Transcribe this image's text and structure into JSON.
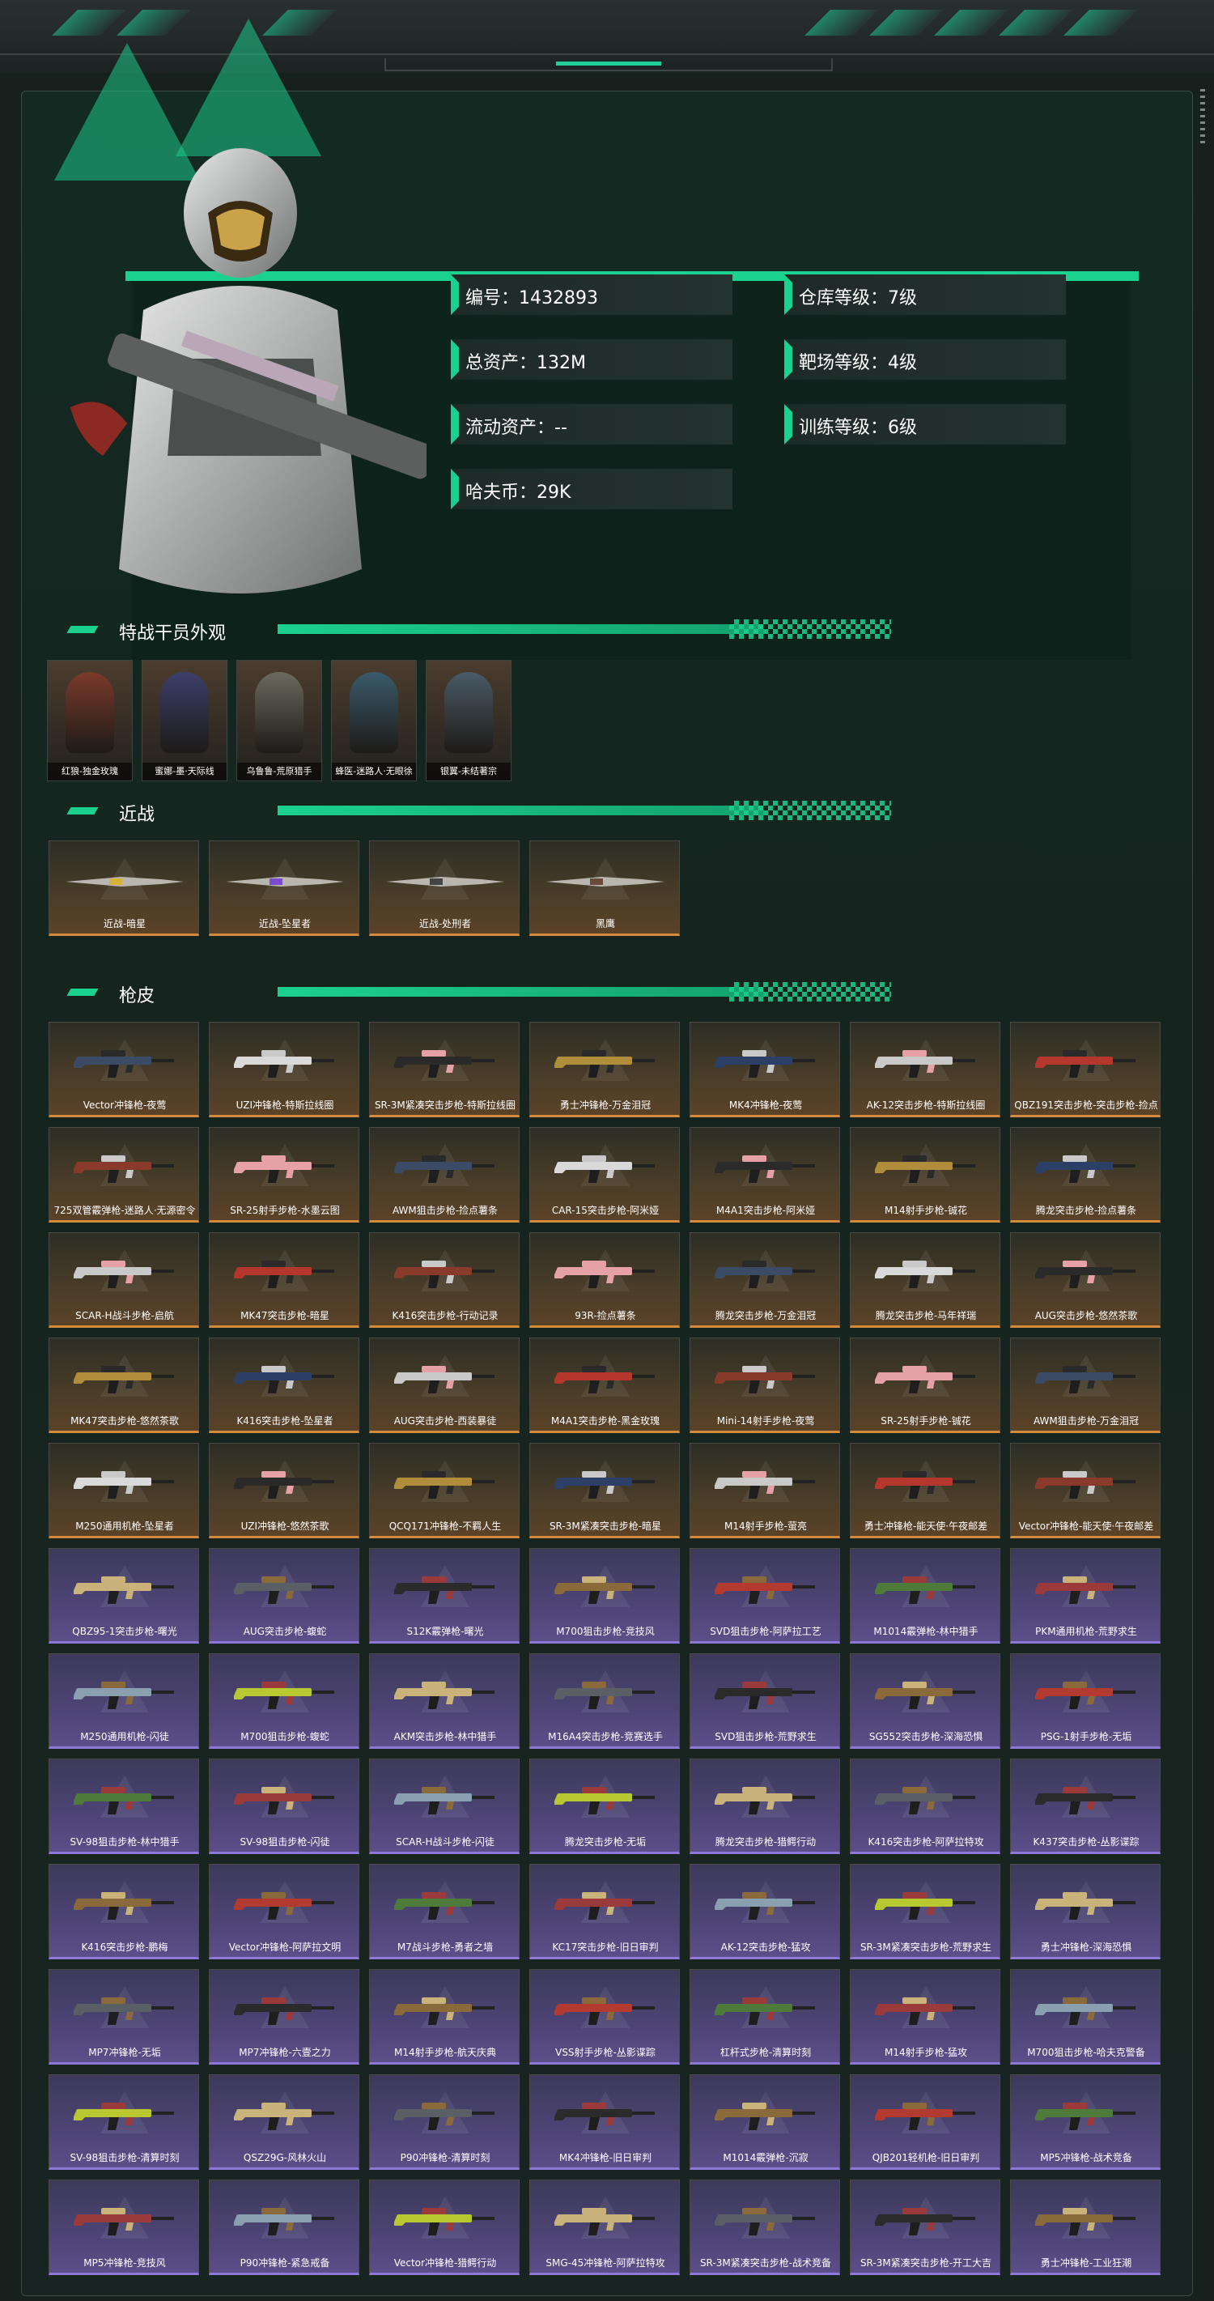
{
  "colors": {
    "accent": "#1bd18e",
    "gold_rarity": "#d38a3a",
    "purple_rarity": "#8e78d8"
  },
  "profile": {
    "id": "编号：1432893",
    "total_assets": "总资产：132M",
    "liquid_assets": "流动资产：--",
    "hafu_coin": "哈夫币：29K",
    "warehouse_level": "仓库等级：7级",
    "range_level": "靶场等级：4级",
    "training_level": "训练等级：6级"
  },
  "sections": {
    "operators": "特战干员外观",
    "melee": "近战",
    "gun_skins": "枪皮"
  },
  "operators": [
    {
      "label": "红狼-独金玫瑰",
      "icon": "operator-portrait-icon"
    },
    {
      "label": "蜜娜-墨·天际线",
      "icon": "operator-portrait-icon"
    },
    {
      "label": "乌鲁鲁-荒原猎手",
      "icon": "operator-portrait-icon"
    },
    {
      "label": "蜂医-迷路人·无眼徐",
      "icon": "operator-portrait-icon"
    },
    {
      "label": "银翼-未结著宗",
      "icon": "operator-portrait-icon"
    }
  ],
  "melee": [
    {
      "label": "近战-暗星",
      "icon": "knife-icon"
    },
    {
      "label": "近战-坠星者",
      "icon": "knife-icon"
    },
    {
      "label": "近战-处刑者",
      "icon": "knife-icon"
    },
    {
      "label": "黑鹰",
      "icon": "knife-icon"
    }
  ],
  "gun_skins": [
    {
      "label": "Vector冲锋枪-夜莺",
      "rarity": "gold"
    },
    {
      "label": "UZI冲锋枪-特斯拉线圈",
      "rarity": "gold"
    },
    {
      "label": "SR-3M紧凑突击步枪-特斯拉线圈",
      "rarity": "gold"
    },
    {
      "label": "勇士冲锋枪-万金泪冠",
      "rarity": "gold"
    },
    {
      "label": "MK4冲锋枪-夜莺",
      "rarity": "gold"
    },
    {
      "label": "AK-12突击步枪-特斯拉线圈",
      "rarity": "gold"
    },
    {
      "label": "QBZ191突击步枪-突击步枪-捡点",
      "rarity": "gold"
    },
    {
      "label": "725双管霰弹枪-迷路人·无源密令",
      "rarity": "gold"
    },
    {
      "label": "SR-25射手步枪-水墨云图",
      "rarity": "gold"
    },
    {
      "label": "AWM狙击步枪-捡点薯条",
      "rarity": "gold"
    },
    {
      "label": "CAR-15突击步枪-阿米娅",
      "rarity": "gold"
    },
    {
      "label": "M4A1突击步枪-阿米娅",
      "rarity": "gold"
    },
    {
      "label": "M14射手步枪-铖花",
      "rarity": "gold"
    },
    {
      "label": "腾龙突击步枪-捡点薯条",
      "rarity": "gold"
    },
    {
      "label": "SCAR-H战斗步枪-启航",
      "rarity": "gold"
    },
    {
      "label": "MK47突击步枪-暗星",
      "rarity": "gold"
    },
    {
      "label": "K416突击步枪-行动记录",
      "rarity": "gold"
    },
    {
      "label": "93R-捡点薯条",
      "rarity": "gold"
    },
    {
      "label": "腾龙突击步枪-万金泪冠",
      "rarity": "gold"
    },
    {
      "label": "腾龙突击步枪-马年祥瑞",
      "rarity": "gold"
    },
    {
      "label": "AUG突击步枪-悠然茶歌",
      "rarity": "gold"
    },
    {
      "label": "MK47突击步枪-悠然茶歌",
      "rarity": "gold"
    },
    {
      "label": "K416突击步枪-坠星者",
      "rarity": "gold"
    },
    {
      "label": "AUG突击步枪-西装暴徒",
      "rarity": "gold"
    },
    {
      "label": "M4A1突击步枪-黑金玫瑰",
      "rarity": "gold"
    },
    {
      "label": "Mini-14射手步枪-夜莺",
      "rarity": "gold"
    },
    {
      "label": "SR-25射手步枪-铖花",
      "rarity": "gold"
    },
    {
      "label": "AWM狙击步枪-万金泪冠",
      "rarity": "gold"
    },
    {
      "label": "M250通用机枪-坠星者",
      "rarity": "gold"
    },
    {
      "label": "UZI冲锋枪-悠然茶歌",
      "rarity": "gold"
    },
    {
      "label": "QCQ171冲锋枪-不羁人生",
      "rarity": "gold"
    },
    {
      "label": "SR-3M紧凑突击步枪-暗星",
      "rarity": "gold"
    },
    {
      "label": "M14射手步枪-萤亮",
      "rarity": "gold"
    },
    {
      "label": "勇士冲锋枪-能天使·午夜邮差",
      "rarity": "gold"
    },
    {
      "label": "Vector冲锋枪-能天使·午夜邮差",
      "rarity": "gold"
    },
    {
      "label": "QBZ95-1突击步枪-曙光",
      "rarity": "purple"
    },
    {
      "label": "AUG突击步枪-蝮蛇",
      "rarity": "purple"
    },
    {
      "label": "S12K霰弹枪-曙光",
      "rarity": "purple"
    },
    {
      "label": "M700狙击步枪-竞技风",
      "rarity": "purple"
    },
    {
      "label": "SVD狙击步枪-阿萨拉工艺",
      "rarity": "purple"
    },
    {
      "label": "M1014霰弹枪-林中猎手",
      "rarity": "purple"
    },
    {
      "label": "PKM通用机枪-荒野求生",
      "rarity": "purple"
    },
    {
      "label": "M250通用机枪-闪徒",
      "rarity": "purple"
    },
    {
      "label": "M700狙击步枪-蝮蛇",
      "rarity": "purple"
    },
    {
      "label": "AKM突击步枪-林中猎手",
      "rarity": "purple"
    },
    {
      "label": "M16A4突击步枪-竞赛选手",
      "rarity": "purple"
    },
    {
      "label": "SVD狙击步枪-荒野求生",
      "rarity": "purple"
    },
    {
      "label": "SG552突击步枪-深海恐惧",
      "rarity": "purple"
    },
    {
      "label": "PSG-1射手步枪-无垢",
      "rarity": "purple"
    },
    {
      "label": "SV-98狙击步枪-林中猎手",
      "rarity": "purple"
    },
    {
      "label": "SV-98狙击步枪-闪徒",
      "rarity": "purple"
    },
    {
      "label": "SCAR-H战斗步枪-闪徒",
      "rarity": "purple"
    },
    {
      "label": "腾龙突击步枪-无垢",
      "rarity": "purple"
    },
    {
      "label": "腾龙突击步枪-猎鳄行动",
      "rarity": "purple"
    },
    {
      "label": "K416突击步枪-阿萨拉特攻",
      "rarity": "purple"
    },
    {
      "label": "K437突击步枪-丛影谍踪",
      "rarity": "purple"
    },
    {
      "label": "K416突击步枪-鹏梅",
      "rarity": "purple"
    },
    {
      "label": "Vector冲锋枪-阿萨拉文明",
      "rarity": "purple"
    },
    {
      "label": "M7战斗步枪-勇者之墙",
      "rarity": "purple"
    },
    {
      "label": "KC17突击步枪-旧日审判",
      "rarity": "purple"
    },
    {
      "label": "AK-12突击步枪-猛攻",
      "rarity": "purple"
    },
    {
      "label": "SR-3M紧凑突击步枪-荒野求生",
      "rarity": "purple"
    },
    {
      "label": "勇士冲锋枪-深海恐惧",
      "rarity": "purple"
    },
    {
      "label": "MP7冲锋枪-无垢",
      "rarity": "purple"
    },
    {
      "label": "MP7冲锋枪-六壹之力",
      "rarity": "purple"
    },
    {
      "label": "M14射手步枪-航天庆典",
      "rarity": "purple"
    },
    {
      "label": "VSS射手步枪-丛影谍踪",
      "rarity": "purple"
    },
    {
      "label": "杠杆式步枪-清算时刻",
      "rarity": "purple"
    },
    {
      "label": "M14射手步枪-猛攻",
      "rarity": "purple"
    },
    {
      "label": "M700狙击步枪-哈夫克警备",
      "rarity": "purple"
    },
    {
      "label": "SV-98狙击步枪-清算时刻",
      "rarity": "purple"
    },
    {
      "label": "QSZ29G-风林火山",
      "rarity": "purple"
    },
    {
      "label": "P90冲锋枪-清算时刻",
      "rarity": "purple"
    },
    {
      "label": "MK4冲锋枪-旧日审判",
      "rarity": "purple"
    },
    {
      "label": "M1014霰弹枪-沉寂",
      "rarity": "purple"
    },
    {
      "label": "QJB201轻机枪-旧日审判",
      "rarity": "purple"
    },
    {
      "label": "MP5冲锋枪-战术竞备",
      "rarity": "purple"
    },
    {
      "label": "MP5冲锋枪-竞技风",
      "rarity": "purple"
    },
    {
      "label": "P90冲锋枪-紧急戒备",
      "rarity": "purple"
    },
    {
      "label": "Vector冲锋枪-猎鳄行动",
      "rarity": "purple"
    },
    {
      "label": "SMG-45冲锋枪-阿萨拉特攻",
      "rarity": "purple"
    },
    {
      "label": "SR-3M紧凑突击步枪-战术竞备",
      "rarity": "purple"
    },
    {
      "label": "SR-3M紧凑突击步枪-开工大吉",
      "rarity": "purple"
    },
    {
      "label": "勇士冲锋枪-工业狂潮",
      "rarity": "purple"
    }
  ]
}
